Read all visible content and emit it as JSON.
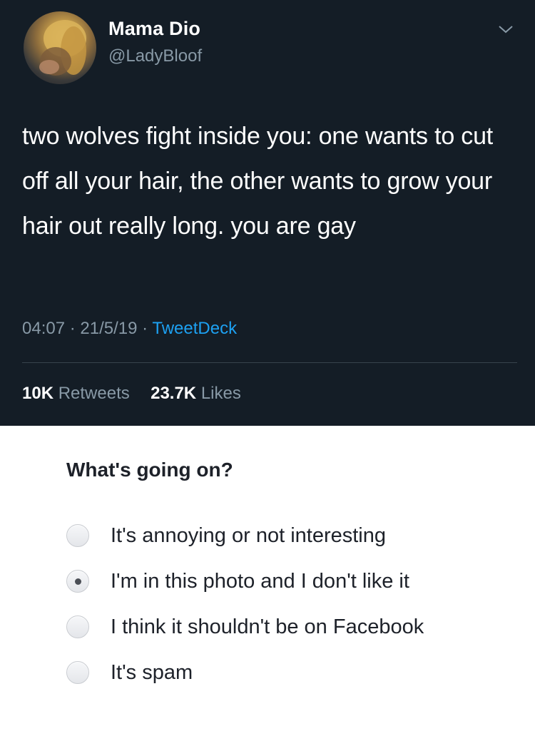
{
  "tweet": {
    "display_name": "Mama Dio",
    "handle": "@LadyBloof",
    "avatar_icon": "avatar-image",
    "menu_icon": "chevron-down-icon",
    "text": "two wolves fight inside you: one wants to cut off all your hair, the other wants to grow your hair out really long. you are gay",
    "time": "04:07",
    "separator": "·",
    "date": "21/5/19",
    "source": "TweetDeck",
    "retweets_count": "10K",
    "retweets_label": "Retweets",
    "likes_count": "23.7K",
    "likes_label": "Likes",
    "colors": {
      "background": "#141d26",
      "secondary_text": "#8899a6",
      "link": "#1da1f2"
    }
  },
  "report": {
    "title": "What's going on?",
    "selected_index": 1,
    "options": [
      {
        "label": "It's annoying or not interesting",
        "checked": false
      },
      {
        "label": "I'm in this photo and I don't like it",
        "checked": true
      },
      {
        "label": "I think it shouldn't be on Facebook",
        "checked": false
      },
      {
        "label": "It's spam",
        "checked": false
      }
    ]
  }
}
